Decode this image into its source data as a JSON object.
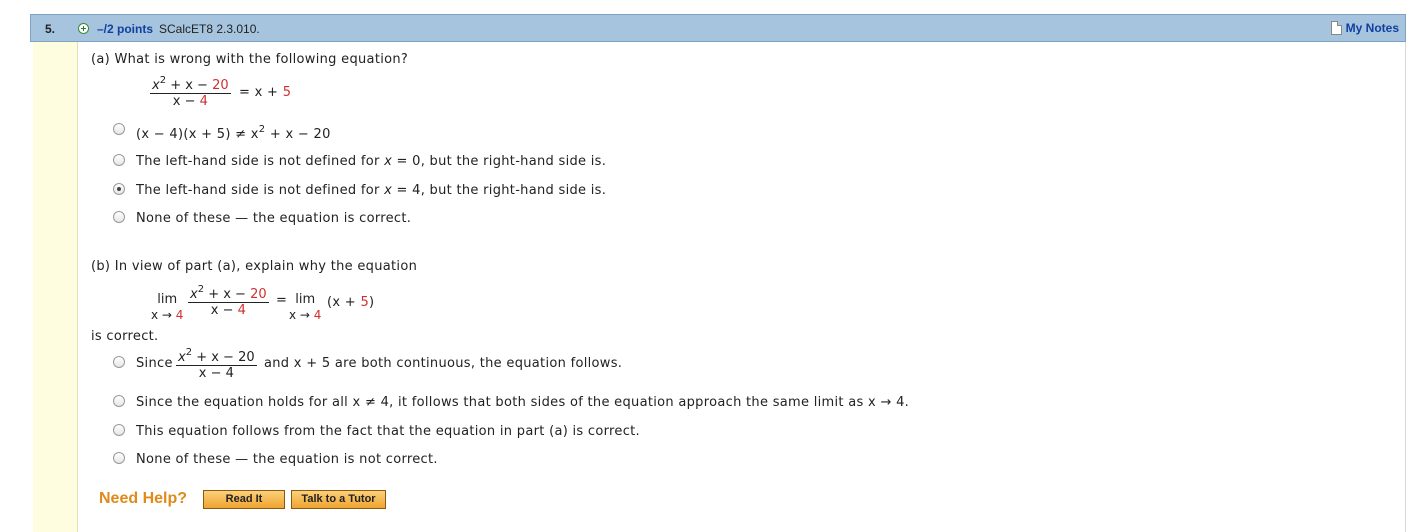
{
  "header": {
    "question_number": "5.",
    "points": "–/2 points",
    "question_id": "SCalcET8 2.3.010.",
    "notes_label": "My Notes",
    "notes_icon": "document-icon",
    "expand_icon": "plus-circle-icon"
  },
  "part_a": {
    "prompt": "(a) What is wrong with the following equation?",
    "equation": {
      "num_a": "x",
      "num_exp": "2",
      "num_b": " + x − ",
      "num_c": "20",
      "den_a": "x − ",
      "den_b": "4",
      "rhs_a": "= x + ",
      "rhs_b": "5"
    },
    "options": [
      {
        "text": "(x − 4)(x + 5) ≠ x",
        "exp": "2",
        "tail": " + x − 20",
        "selected": false
      },
      {
        "pre": "The left-hand side is not defined for ",
        "var": "x",
        "post": " = 0, but the right-hand side is.",
        "selected": false
      },
      {
        "pre": "The left-hand side is not defined for ",
        "var": "x",
        "post": " = 4, but the right-hand side is.",
        "selected": true
      },
      {
        "text": "None of these — the equation is correct.",
        "selected": false
      }
    ]
  },
  "part_b": {
    "prompt": "(b) In view of part (a), explain why the equation",
    "equation": {
      "lim": "lim",
      "sub_a": "x → ",
      "sub_b": "4",
      "num_a": "x",
      "num_exp": "2",
      "num_b": " + x − ",
      "num_c": "20",
      "den_a": "x − ",
      "den_b": "4",
      "eq": "=",
      "rhs_a": "(x + ",
      "rhs_b": "5",
      "rhs_c": ")"
    },
    "after": "is correct.",
    "options": [
      {
        "pre": "Since",
        "frac_num": "x",
        "frac_exp": "2",
        "frac_num_tail": " + x − 20",
        "frac_den": "x − 4",
        "post": "and x + 5 are both continuous, the equation follows.",
        "selected": false
      },
      {
        "text": "Since the equation holds for all x ≠ 4, it follows that both sides of the equation approach the same limit as x → 4.",
        "selected": false
      },
      {
        "text": "This equation follows from the fact that the equation in part (a) is correct.",
        "selected": false
      },
      {
        "text": "None of these — the equation is not correct.",
        "selected": false
      }
    ]
  },
  "help": {
    "label": "Need Help?",
    "read_it": "Read It",
    "talk_tutor": "Talk to a Tutor"
  }
}
